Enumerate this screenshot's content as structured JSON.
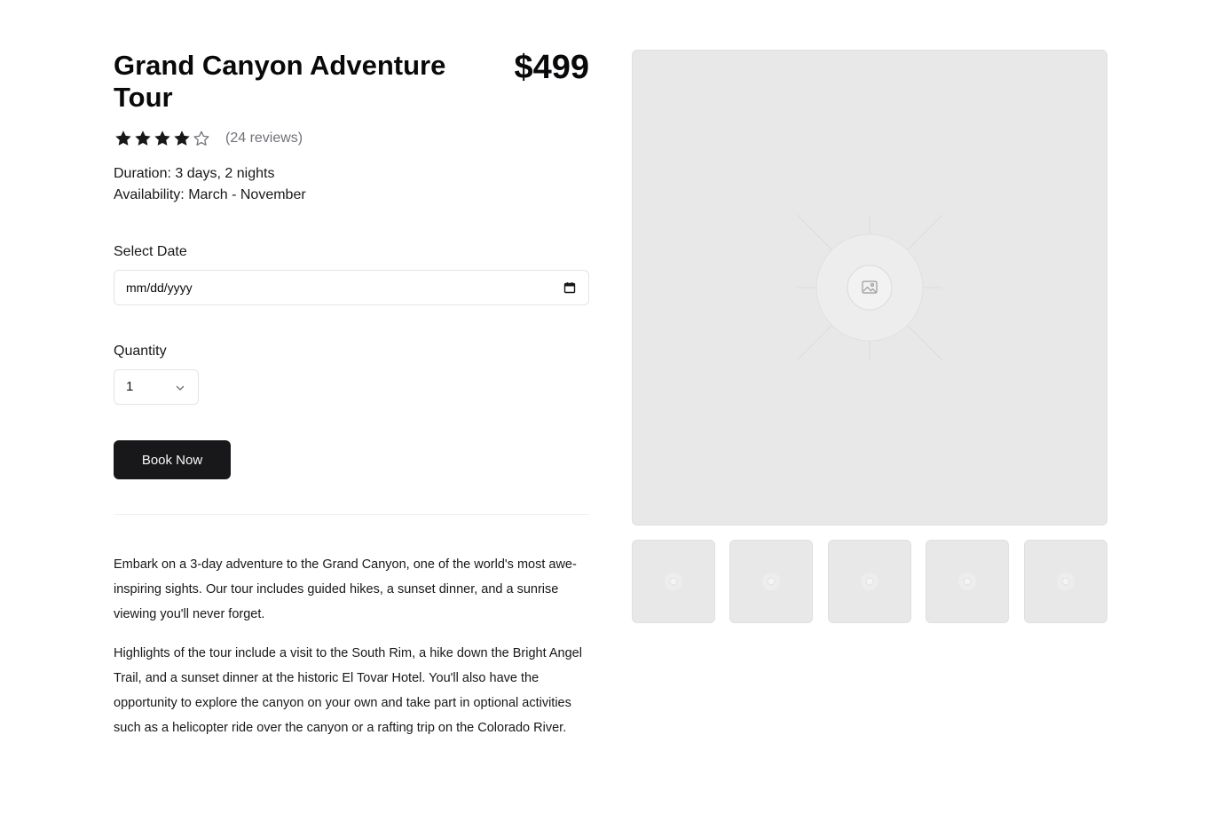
{
  "product": {
    "title": "Grand Canyon Adventure Tour",
    "price": "$499",
    "rating": 4,
    "rating_max": 5,
    "reviews": "(24 reviews)",
    "duration": "Duration: 3 days, 2 nights",
    "availability": "Availability: March - November"
  },
  "booking": {
    "date_label": "Select Date",
    "date_placeholder": "mm/dd/yyyy",
    "quantity_label": "Quantity",
    "quantity_value": "1",
    "book_button": "Book Now"
  },
  "description": {
    "paragraph_1": "Embark on a 3-day adventure to the Grand Canyon, one of the world's most awe-inspiring sights. Our tour includes guided hikes, a sunset dinner, and a sunrise viewing you'll never forget.",
    "paragraph_2": "Highlights of the tour include a visit to the South Rim, a hike down the Bright Angel Trail, and a sunset dinner at the historic El Tovar Hotel. You'll also have the opportunity to explore the canyon on your own and take part in optional activities such as a helicopter ride over the canyon or a rafting trip on the Colorado River."
  },
  "gallery": {
    "main_icon": "image-placeholder-icon",
    "thumbnail_count": 5
  },
  "colors": {
    "primary": "#18181b",
    "muted_text": "#71717a",
    "border": "#e4e4e7",
    "placeholder_bg": "#e8e8e8"
  }
}
